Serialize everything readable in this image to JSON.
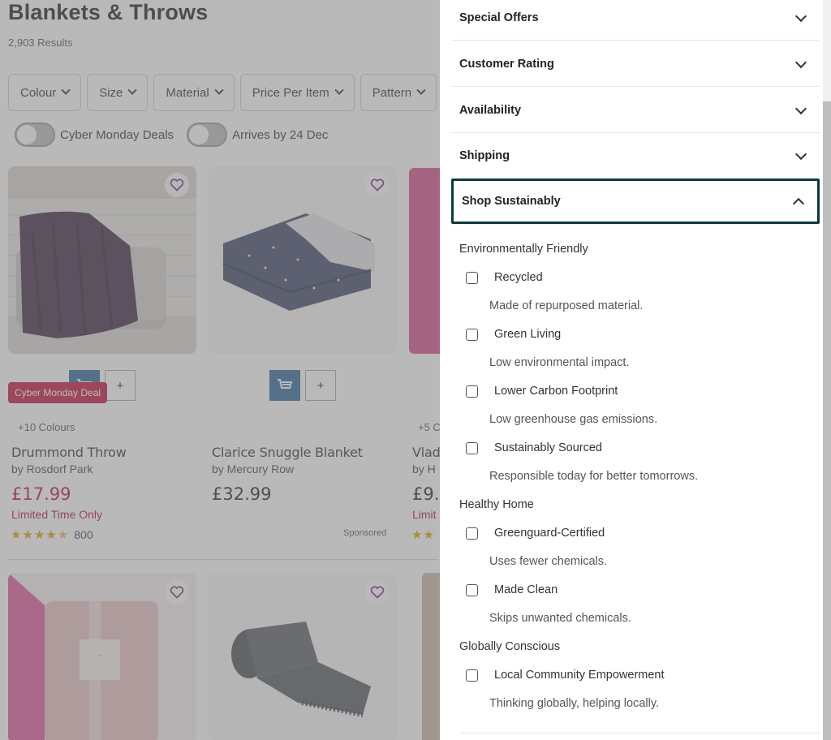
{
  "page": {
    "title": "Blankets & Throws",
    "results": "2,903 Results"
  },
  "filters": [
    {
      "label": "Colour"
    },
    {
      "label": "Size"
    },
    {
      "label": "Material"
    },
    {
      "label": "Price Per Item"
    },
    {
      "label": "Pattern"
    }
  ],
  "toggles": [
    {
      "label": "Cyber Monday Deals",
      "on": false
    },
    {
      "label": "Arrives by 24 Dec",
      "on": false
    }
  ],
  "products": [
    {
      "badge": "Cyber Monday Deal",
      "colours": "+10 Colours",
      "name": "Drummond Throw",
      "brand": "by Rosdorf Park",
      "price": "£17.99",
      "limited": "Limited Time Only",
      "rating": 4.5,
      "reviews": "800"
    },
    {
      "name": "Clarice Snuggle Blanket",
      "brand": "by Mercury Row",
      "price": "£32.99",
      "sponsored": "Sponsored",
      "add_symbol": "+"
    },
    {
      "colours": "+5 C",
      "name": "Vlad",
      "brand": "by H",
      "price": "£9.",
      "limited": "Limit"
    }
  ],
  "drawer": {
    "accordion": [
      {
        "title": "Special Offers",
        "open": false
      },
      {
        "title": "Customer Rating",
        "open": false
      },
      {
        "title": "Availability",
        "open": false
      },
      {
        "title": "Shipping",
        "open": false
      },
      {
        "title": "Shop Sustainably",
        "open": true
      }
    ],
    "groups": [
      {
        "title": "Environmentally Friendly",
        "options": [
          {
            "label": "Recycled",
            "desc": "Made of repurposed material.",
            "checked": false
          },
          {
            "label": "Green Living",
            "desc": "Low environmental impact.",
            "checked": false
          },
          {
            "label": "Lower Carbon Footprint",
            "desc": "Low greenhouse gas emissions.",
            "checked": false
          },
          {
            "label": "Sustainably Sourced",
            "desc": "Responsible today for better tomorrows.",
            "checked": false
          }
        ]
      },
      {
        "title": "Healthy Home",
        "options": [
          {
            "label": "Greenguard-Certified",
            "desc": "Uses fewer chemicals.",
            "checked": false
          },
          {
            "label": "Made Clean",
            "desc": "Skips unwanted chemicals.",
            "checked": false
          }
        ]
      },
      {
        "title": "Globally Conscious",
        "options": [
          {
            "label": "Local Community Empowerment",
            "desc": "Thinking globally, helping locally.",
            "checked": false
          }
        ]
      }
    ]
  },
  "colors": {
    "accent_sale": "#b3123b",
    "deal_badge": "#c2113d",
    "cart_button": "#2d6a9b",
    "focus_border": "#0f3a3c",
    "star": "#e0a100"
  }
}
